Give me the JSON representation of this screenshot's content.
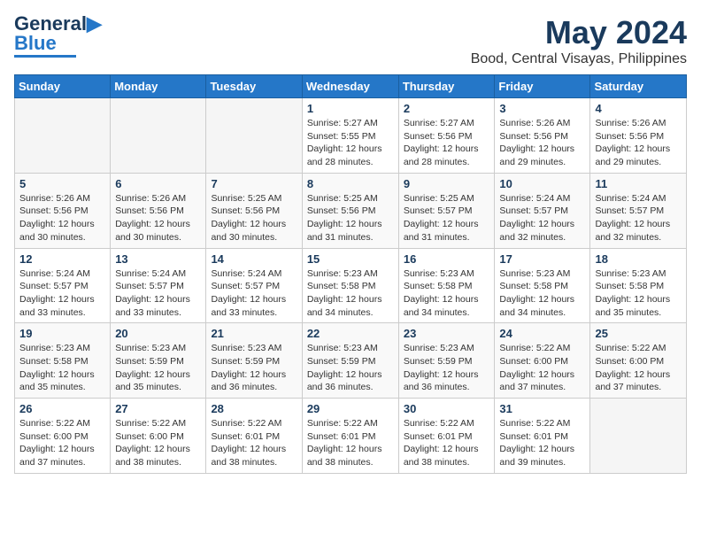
{
  "logo": {
    "text1": "General",
    "text2": "Blue"
  },
  "title": "May 2024",
  "subtitle": "Bood, Central Visayas, Philippines",
  "days": [
    "Sunday",
    "Monday",
    "Tuesday",
    "Wednesday",
    "Thursday",
    "Friday",
    "Saturday"
  ],
  "weeks": [
    [
      {
        "day": "",
        "info": ""
      },
      {
        "day": "",
        "info": ""
      },
      {
        "day": "",
        "info": ""
      },
      {
        "day": "1",
        "info": "Sunrise: 5:27 AM\nSunset: 5:55 PM\nDaylight: 12 hours\nand 28 minutes."
      },
      {
        "day": "2",
        "info": "Sunrise: 5:27 AM\nSunset: 5:56 PM\nDaylight: 12 hours\nand 28 minutes."
      },
      {
        "day": "3",
        "info": "Sunrise: 5:26 AM\nSunset: 5:56 PM\nDaylight: 12 hours\nand 29 minutes."
      },
      {
        "day": "4",
        "info": "Sunrise: 5:26 AM\nSunset: 5:56 PM\nDaylight: 12 hours\nand 29 minutes."
      }
    ],
    [
      {
        "day": "5",
        "info": "Sunrise: 5:26 AM\nSunset: 5:56 PM\nDaylight: 12 hours\nand 30 minutes."
      },
      {
        "day": "6",
        "info": "Sunrise: 5:26 AM\nSunset: 5:56 PM\nDaylight: 12 hours\nand 30 minutes."
      },
      {
        "day": "7",
        "info": "Sunrise: 5:25 AM\nSunset: 5:56 PM\nDaylight: 12 hours\nand 30 minutes."
      },
      {
        "day": "8",
        "info": "Sunrise: 5:25 AM\nSunset: 5:56 PM\nDaylight: 12 hours\nand 31 minutes."
      },
      {
        "day": "9",
        "info": "Sunrise: 5:25 AM\nSunset: 5:57 PM\nDaylight: 12 hours\nand 31 minutes."
      },
      {
        "day": "10",
        "info": "Sunrise: 5:24 AM\nSunset: 5:57 PM\nDaylight: 12 hours\nand 32 minutes."
      },
      {
        "day": "11",
        "info": "Sunrise: 5:24 AM\nSunset: 5:57 PM\nDaylight: 12 hours\nand 32 minutes."
      }
    ],
    [
      {
        "day": "12",
        "info": "Sunrise: 5:24 AM\nSunset: 5:57 PM\nDaylight: 12 hours\nand 33 minutes."
      },
      {
        "day": "13",
        "info": "Sunrise: 5:24 AM\nSunset: 5:57 PM\nDaylight: 12 hours\nand 33 minutes."
      },
      {
        "day": "14",
        "info": "Sunrise: 5:24 AM\nSunset: 5:57 PM\nDaylight: 12 hours\nand 33 minutes."
      },
      {
        "day": "15",
        "info": "Sunrise: 5:23 AM\nSunset: 5:58 PM\nDaylight: 12 hours\nand 34 minutes."
      },
      {
        "day": "16",
        "info": "Sunrise: 5:23 AM\nSunset: 5:58 PM\nDaylight: 12 hours\nand 34 minutes."
      },
      {
        "day": "17",
        "info": "Sunrise: 5:23 AM\nSunset: 5:58 PM\nDaylight: 12 hours\nand 34 minutes."
      },
      {
        "day": "18",
        "info": "Sunrise: 5:23 AM\nSunset: 5:58 PM\nDaylight: 12 hours\nand 35 minutes."
      }
    ],
    [
      {
        "day": "19",
        "info": "Sunrise: 5:23 AM\nSunset: 5:58 PM\nDaylight: 12 hours\nand 35 minutes."
      },
      {
        "day": "20",
        "info": "Sunrise: 5:23 AM\nSunset: 5:59 PM\nDaylight: 12 hours\nand 35 minutes."
      },
      {
        "day": "21",
        "info": "Sunrise: 5:23 AM\nSunset: 5:59 PM\nDaylight: 12 hours\nand 36 minutes."
      },
      {
        "day": "22",
        "info": "Sunrise: 5:23 AM\nSunset: 5:59 PM\nDaylight: 12 hours\nand 36 minutes."
      },
      {
        "day": "23",
        "info": "Sunrise: 5:23 AM\nSunset: 5:59 PM\nDaylight: 12 hours\nand 36 minutes."
      },
      {
        "day": "24",
        "info": "Sunrise: 5:22 AM\nSunset: 6:00 PM\nDaylight: 12 hours\nand 37 minutes."
      },
      {
        "day": "25",
        "info": "Sunrise: 5:22 AM\nSunset: 6:00 PM\nDaylight: 12 hours\nand 37 minutes."
      }
    ],
    [
      {
        "day": "26",
        "info": "Sunrise: 5:22 AM\nSunset: 6:00 PM\nDaylight: 12 hours\nand 37 minutes."
      },
      {
        "day": "27",
        "info": "Sunrise: 5:22 AM\nSunset: 6:00 PM\nDaylight: 12 hours\nand 38 minutes."
      },
      {
        "day": "28",
        "info": "Sunrise: 5:22 AM\nSunset: 6:01 PM\nDaylight: 12 hours\nand 38 minutes."
      },
      {
        "day": "29",
        "info": "Sunrise: 5:22 AM\nSunset: 6:01 PM\nDaylight: 12 hours\nand 38 minutes."
      },
      {
        "day": "30",
        "info": "Sunrise: 5:22 AM\nSunset: 6:01 PM\nDaylight: 12 hours\nand 38 minutes."
      },
      {
        "day": "31",
        "info": "Sunrise: 5:22 AM\nSunset: 6:01 PM\nDaylight: 12 hours\nand 39 minutes."
      },
      {
        "day": "",
        "info": ""
      }
    ]
  ]
}
